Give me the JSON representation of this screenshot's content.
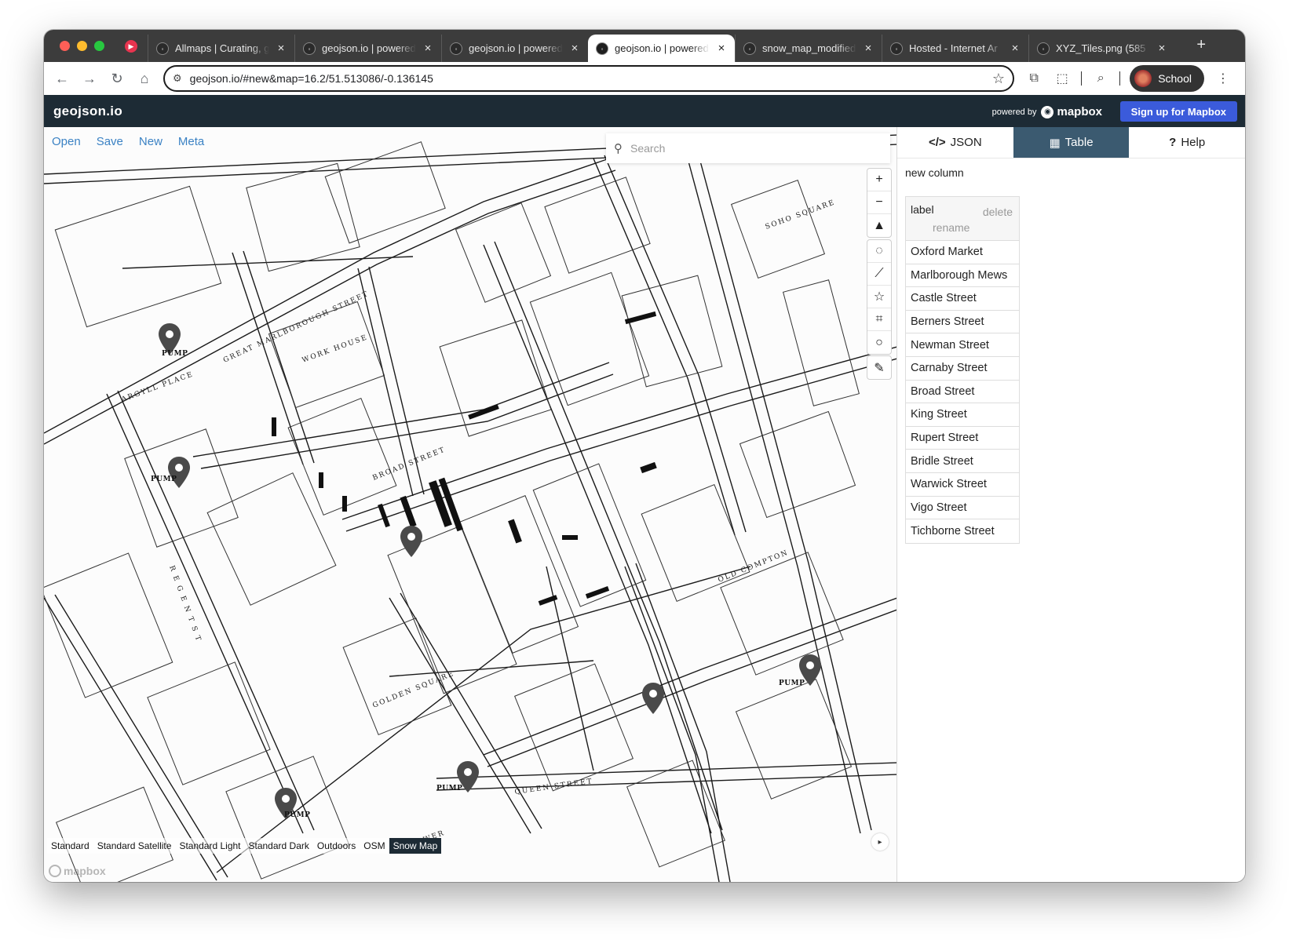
{
  "browser": {
    "tabs": [
      {
        "title": "Allmaps | Curating, g",
        "icon": "allmaps-icon",
        "active": false
      },
      {
        "title": "geojson.io | powered",
        "icon": "geojson-icon",
        "active": false
      },
      {
        "title": "geojson.io | powered",
        "icon": "geojson-icon",
        "active": false
      },
      {
        "title": "geojson.io | powered",
        "icon": "geojson-icon",
        "active": true
      },
      {
        "title": "snow_map_modified",
        "icon": "archive-icon",
        "active": false
      },
      {
        "title": "Hosted - Internet Ar",
        "icon": "archive-icon",
        "active": false
      },
      {
        "title": "XYZ_Tiles.png (585",
        "icon": "image-icon",
        "active": false
      }
    ],
    "url": "geojson.io/#new&map=16.2/51.513086/-0.136145",
    "profile_label": "School"
  },
  "app": {
    "brand": "geojson.io",
    "powered_by": "powered by",
    "mapbox": "mapbox",
    "signup": "Sign up for Mapbox"
  },
  "file_menu": {
    "open": "Open",
    "save": "Save",
    "new": "New",
    "meta": "Meta"
  },
  "search": {
    "placeholder": "Search"
  },
  "layers": [
    "Standard",
    "Standard Satellite",
    "Standard Light",
    "Standard Dark",
    "Outdoors",
    "OSM",
    "Snow Map"
  ],
  "active_layer": "Snow Map",
  "map_labels": {
    "pump": "PUMP"
  },
  "sidebar": {
    "tabs": {
      "json": "JSON",
      "table": "Table",
      "help": "Help"
    },
    "active_tab": "Table",
    "new_column": "new column",
    "column": {
      "label": "label",
      "delete": "delete",
      "rename": "rename"
    },
    "rows": [
      "Oxford Market",
      "Marlborough Mews",
      "Castle Street",
      "Berners Street",
      "Newman Street",
      "Carnaby Street",
      "Broad Street",
      "King Street",
      "Rupert Street",
      "Bridle Street",
      "Warwick Street",
      "Vigo Street",
      "Tichborne Street"
    ]
  },
  "colors": {
    "app_header": "#1d2b35",
    "signup": "#3b5bdb",
    "active_tab": "#3b5a70",
    "link": "#3b82c4"
  }
}
